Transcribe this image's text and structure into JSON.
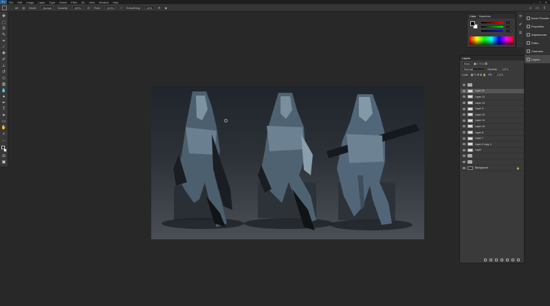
{
  "app": {
    "logo": "Ps"
  },
  "menu": [
    "File",
    "Edit",
    "Image",
    "Layer",
    "Type",
    "Select",
    "Filter",
    "3D",
    "View",
    "Window",
    "Help"
  ],
  "options": {
    "mode_label": "Mode:",
    "mode_value": "Normal",
    "opacity_label": "Opacity:",
    "opacity_value": "100%",
    "flow_label": "Flow:",
    "flow_value": "100%",
    "smoothing_label": "Smoothing:",
    "smoothing_value": "10%"
  },
  "toolbar": {
    "tools": [
      "move",
      "marquee",
      "lasso",
      "quick-select",
      "crop",
      "eyedropper",
      "healing",
      "brush",
      "clone-stamp",
      "history-brush",
      "eraser",
      "gradient",
      "blur",
      "dodge",
      "pen",
      "type",
      "path-select",
      "rectangle",
      "hand",
      "zoom",
      "more"
    ]
  },
  "right_dock": {
    "items": [
      {
        "label": "Brush Presets"
      },
      {
        "label": "Properties"
      },
      {
        "label": "Adjustments"
      },
      {
        "label": "Paths"
      },
      {
        "label": "Channels"
      },
      {
        "label": "Layers"
      }
    ]
  },
  "color_panel": {
    "tabs": [
      "Color",
      "Swatches"
    ],
    "values": [
      "0",
      "0",
      "0"
    ]
  },
  "layers_panel": {
    "title": "Layers",
    "kind_label": "Kind",
    "blend_value": "Normal",
    "opacity_label": "Opacity:",
    "opacity_value": "100%",
    "lock_label": "Lock:",
    "fill_label": "Fill:",
    "fill_value": "100%",
    "layers": [
      {
        "name": "",
        "type": "folder"
      },
      {
        "name": "Layer 11",
        "type": "layer",
        "selected": true
      },
      {
        "name": "Layer 12",
        "type": "layer"
      },
      {
        "name": "Layer 13",
        "type": "layer"
      },
      {
        "name": "Layer 9",
        "type": "layer"
      },
      {
        "name": "Layer 15",
        "type": "layer"
      },
      {
        "name": "Layer 14",
        "type": "layer"
      },
      {
        "name": "Layer 10",
        "type": "layer"
      },
      {
        "name": "Layer 8",
        "type": "layer"
      },
      {
        "name": "Layer 7",
        "type": "layer"
      },
      {
        "name": "Layer 2 copy 4",
        "type": "layer"
      },
      {
        "name": "Layer",
        "type": "layer"
      },
      {
        "name": "",
        "type": "folder"
      },
      {
        "name": "",
        "type": "folder"
      },
      {
        "name": "Background",
        "type": "background"
      }
    ]
  }
}
